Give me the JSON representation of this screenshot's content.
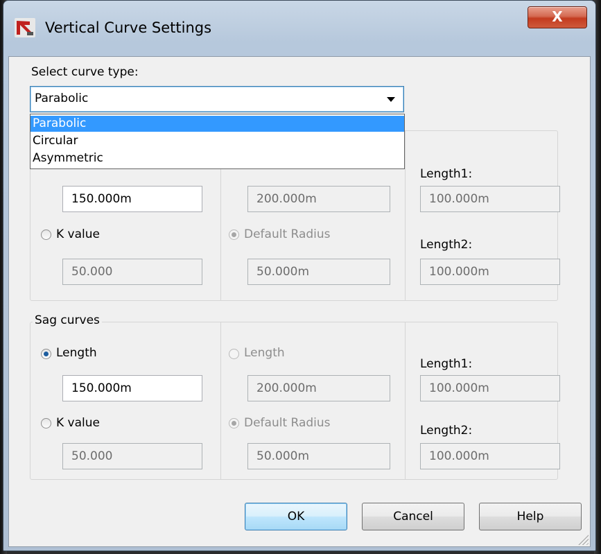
{
  "window": {
    "title": "Vertical Curve Settings",
    "close_glyph": "X"
  },
  "curve_type": {
    "label": "Select curve type:",
    "selected": "Parabolic",
    "options": [
      "Parabolic",
      "Circular",
      "Asymmetric"
    ]
  },
  "crest": {
    "length_value": "150.000m",
    "k_label": "K value",
    "k_value": "50.000",
    "circ_length_value": "200.000m",
    "default_radius_label": "Default Radius",
    "default_radius_value": "50.000m",
    "length1_label": "Length1:",
    "length1_value": "100.000m",
    "length2_label": "Length2:",
    "length2_value": "100.000m"
  },
  "sag": {
    "legend": "Sag curves",
    "length_label": "Length",
    "length_value": "150.000m",
    "k_label": "K value",
    "k_value": "50.000",
    "circ_length_label": "Length",
    "circ_length_value": "200.000m",
    "default_radius_label": "Default Radius",
    "default_radius_value": "50.000m",
    "length1_label": "Length1:",
    "length1_value": "100.000m",
    "length2_label": "Length2:",
    "length2_value": "100.000m"
  },
  "buttons": {
    "ok": "OK",
    "cancel": "Cancel",
    "help": "Help"
  },
  "colors": {
    "highlight": "#3399ff",
    "close_red": "#c33b1f"
  }
}
